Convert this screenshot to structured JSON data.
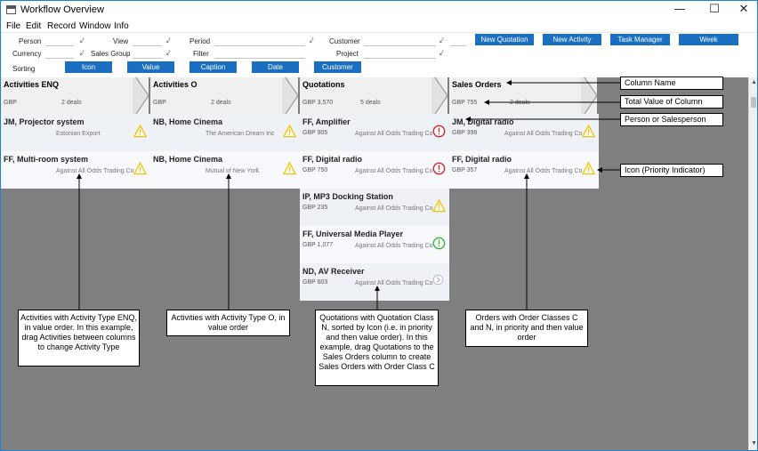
{
  "window": {
    "title": "Workflow Overview",
    "min_label": "—",
    "max_label": "☐",
    "close_label": "✕"
  },
  "menu": [
    "File",
    "Edit",
    "Record",
    "Window",
    "Info"
  ],
  "filters": {
    "person": "Person",
    "currency": "Currency",
    "sorting": "Sorting",
    "view": "View",
    "sales_group": "Sales Group",
    "period": "Period",
    "filter": "Filter",
    "customer": "Customer",
    "project": "Project"
  },
  "sort_buttons": [
    "Icon",
    "Value",
    "Caption",
    "Date",
    "Customer"
  ],
  "action_buttons": [
    "New Quotation",
    "New Activity",
    "Task Manager",
    "Week"
  ],
  "columns": [
    {
      "name": "Activities ENQ",
      "total": "GBP",
      "deals": "2 deals",
      "cards": [
        {
          "title": "JM, Projector system",
          "value": "",
          "sub": "Estonian Export",
          "prio": "warning"
        },
        {
          "title": "FF, Multi-room system",
          "value": "",
          "sub": "Against All Odds Trading Co",
          "prio": "warning"
        }
      ]
    },
    {
      "name": "Activities O",
      "total": "GBP",
      "deals": "2 deals",
      "cards": [
        {
          "title": "NB, Home Cinema",
          "value": "",
          "sub": "The American Dream Inc",
          "prio": "warning"
        },
        {
          "title": "NB, Home Cinema",
          "value": "",
          "sub": "Mutual of New York",
          "prio": "warning"
        }
      ]
    },
    {
      "name": "Quotations",
      "total": "GBP 3,570",
      "deals": "5 deals",
      "cards": [
        {
          "title": "FF, Amplifier",
          "value": "GBP 905",
          "sub": "Against All Odds Trading Co",
          "prio": "error"
        },
        {
          "title": "FF, Digital radio",
          "value": "GBP 750",
          "sub": "Against All Odds Trading Co",
          "prio": "error"
        },
        {
          "title": "IP, MP3 Docking Station",
          "value": "GBP 235",
          "sub": "Against All Odds Trading Co",
          "prio": "warning"
        },
        {
          "title": "FF, Universal Media Player",
          "value": "GBP 1,077",
          "sub": "Against All Odds Trading Co",
          "prio": "ok"
        },
        {
          "title": "ND, AV Receiver",
          "value": "GBP 603",
          "sub": "Against All Odds Trading Co",
          "prio": "arrow"
        }
      ]
    },
    {
      "name": "Sales Orders",
      "total": "GBP 755",
      "deals": "2 deals",
      "cards": [
        {
          "title": "JM, Digital radio",
          "value": "GBP 398",
          "sub": "Against All Odds Trading Co",
          "prio": "warning"
        },
        {
          "title": "FF, Digital radio",
          "value": "GBP 357",
          "sub": "Against All Odds Trading Co",
          "prio": "warning"
        }
      ]
    }
  ],
  "callouts": [
    "Column Name",
    "Total Value of Column",
    "Person or Salesperson",
    "Icon (Priority Indicator)"
  ],
  "notes": [
    "Activities with Activity Type ENQ, in value order. In this example, drag Activities between columns to change Activity Type",
    "Activities with Activity Type O, in value order",
    "Quotations with Quotation Class N, sorted by Icon (i.e. in priority and then value order). In this example, drag Quotations to the Sales Orders column to create Sales Orders with Order Class C",
    "Orders with Order Classes C and N, in priority and then value order"
  ],
  "colors": {
    "button": "#1b6fc0",
    "warning": "#f2c200",
    "error": "#d61f26",
    "ok": "#2eb82e",
    "board": "#7f7f7f"
  }
}
